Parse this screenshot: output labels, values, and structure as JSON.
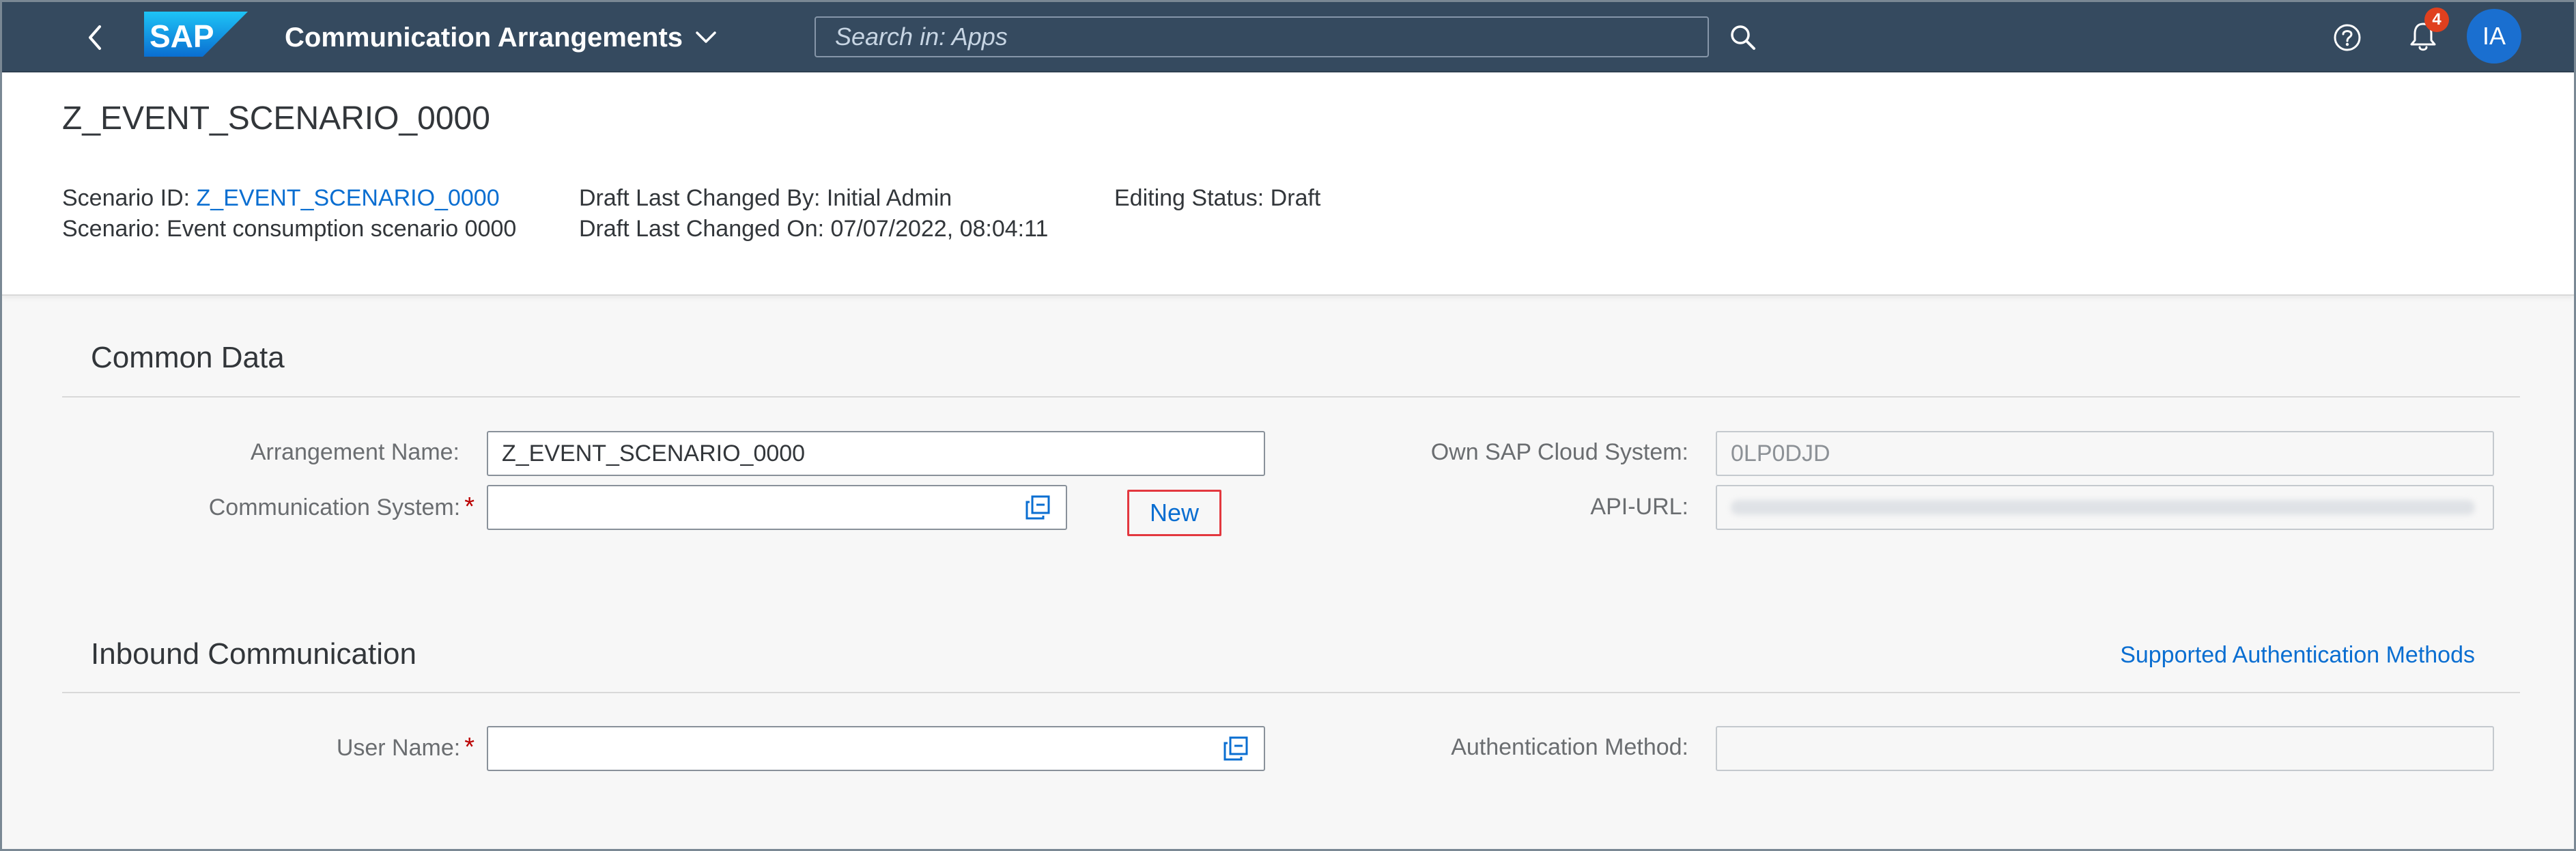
{
  "shell": {
    "logo_text": "SAP",
    "app_title": "Communication Arrangements",
    "search_placeholder": "Search in: Apps",
    "notification_count": "4",
    "avatar_initials": "IA"
  },
  "header": {
    "title": "Z_EVENT_SCENARIO_0000",
    "scenario_id_label": "Scenario ID: ",
    "scenario_id_value": "Z_EVENT_SCENARIO_0000",
    "scenario_label": "Scenario: Event consumption scenario 0000",
    "draft_changed_by": "Draft Last Changed By: Initial Admin",
    "draft_changed_on": "Draft Last Changed On: 07/07/2022, 08:04:11",
    "editing_status": "Editing Status: Draft"
  },
  "common_data": {
    "section_title": "Common Data",
    "arrangement_name_label": "Arrangement Name:",
    "arrangement_name_value": "Z_EVENT_SCENARIO_0000",
    "communication_system_label": "Communication System:",
    "communication_system_value": "",
    "required_marker": "*",
    "new_button_label": "New",
    "own_system_label": "Own SAP Cloud System:",
    "own_system_value": "0LP0DJD",
    "api_url_label": "API-URL:"
  },
  "inbound": {
    "section_title": "Inbound Communication",
    "supported_auth_link": "Supported Authentication Methods",
    "user_name_label": "User Name:",
    "user_name_value": "",
    "required_marker": "*",
    "auth_method_label": "Authentication Method:",
    "auth_method_value": ""
  },
  "colors": {
    "shell_bar": "#354a5f",
    "link": "#0a6ed1",
    "required": "#bb0000",
    "badge": "#e0401e",
    "avatar": "#1a6fd0",
    "highlight_box": "#e3383f"
  }
}
